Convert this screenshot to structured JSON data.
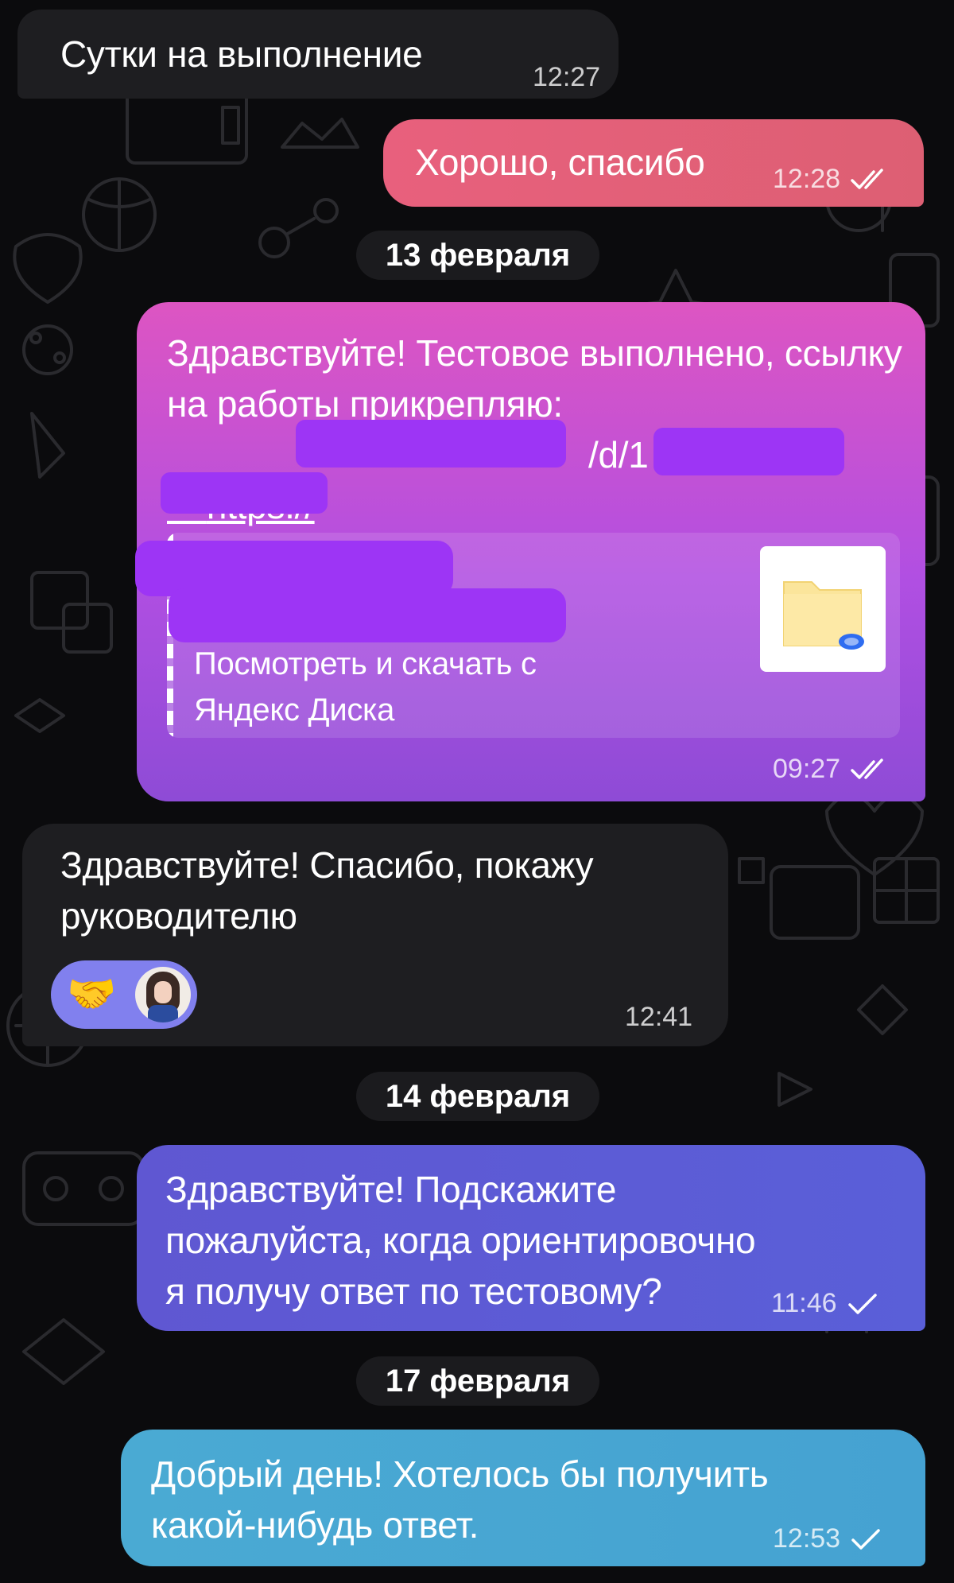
{
  "theme": {
    "background": "#0b0b0d",
    "incoming_bubble": "#1e1e21",
    "outgoing_gradients": [
      "#e6607f",
      "#b34fe0",
      "#5b5cd6",
      "#49a8d4"
    ],
    "redaction_color": "#9d35f5"
  },
  "messages": [
    {
      "id": "m1",
      "direction": "incoming",
      "text": "Сутки на выполнение",
      "time": "12:27"
    },
    {
      "id": "m2",
      "direction": "outgoing",
      "text": "Хорошо, спасибо",
      "time": "12:28",
      "status": "read"
    },
    {
      "id": "d1",
      "type": "date",
      "label": "13 февраля"
    },
    {
      "id": "m3",
      "direction": "outgoing",
      "text": "Здравствуйте! Тестовое выполнено, ссылку на работы прикрепляю:",
      "link_start": "https://",
      "link_mid": "/d/1",
      "link_preview": {
        "description": "Посмотреть и скачать с Яндекс Диска",
        "thumbnail_icon": "folder-cloud-icon"
      },
      "time": "09:27",
      "status": "read"
    },
    {
      "id": "m4",
      "direction": "incoming",
      "text": "Здравствуйте! Спасибо, покажу руководителю",
      "reaction": {
        "emoji": "🤝",
        "reactor": "avatar"
      },
      "time": "12:41"
    },
    {
      "id": "d2",
      "type": "date",
      "label": "14 февраля"
    },
    {
      "id": "m5",
      "direction": "outgoing",
      "text": "Здравствуйте! Подскажите пожалуйста, когда ориентировочно я получу ответ по тестовому?",
      "time": "11:46",
      "status": "sent"
    },
    {
      "id": "d3",
      "type": "date",
      "label": "17 февраля"
    },
    {
      "id": "m6",
      "direction": "outgoing",
      "text": "Добрый день! Хотелось бы получить какой-нибудь ответ.",
      "time": "12:53",
      "status": "sent"
    }
  ]
}
